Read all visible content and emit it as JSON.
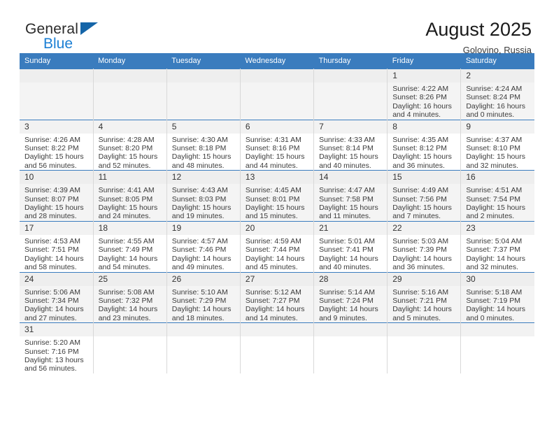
{
  "brand": {
    "name_part1": "General",
    "name_part2": "Blue",
    "triangle_icon": "triangle-icon",
    "accent_color": "#1b7fd4"
  },
  "header": {
    "title": "August 2025",
    "subtitle": "Golovino, Russia"
  },
  "theme": {
    "header_blue": "#3a7cbe",
    "row_alt": "#f4f4f4",
    "daynum_strip": "#eeeeee"
  },
  "weekday_headers": [
    "Sunday",
    "Monday",
    "Tuesday",
    "Wednesday",
    "Thursday",
    "Friday",
    "Saturday"
  ],
  "weeks": [
    [
      {
        "day": "",
        "empty": true
      },
      {
        "day": "",
        "empty": true
      },
      {
        "day": "",
        "empty": true
      },
      {
        "day": "",
        "empty": true
      },
      {
        "day": "",
        "empty": true
      },
      {
        "day": "1",
        "sunrise": "Sunrise: 4:22 AM",
        "sunset": "Sunset: 8:26 PM",
        "daylight_line1": "Daylight: 16 hours",
        "daylight_line2": "and 4 minutes."
      },
      {
        "day": "2",
        "sunrise": "Sunrise: 4:24 AM",
        "sunset": "Sunset: 8:24 PM",
        "daylight_line1": "Daylight: 16 hours",
        "daylight_line2": "and 0 minutes."
      }
    ],
    [
      {
        "day": "3",
        "sunrise": "Sunrise: 4:26 AM",
        "sunset": "Sunset: 8:22 PM",
        "daylight_line1": "Daylight: 15 hours",
        "daylight_line2": "and 56 minutes."
      },
      {
        "day": "4",
        "sunrise": "Sunrise: 4:28 AM",
        "sunset": "Sunset: 8:20 PM",
        "daylight_line1": "Daylight: 15 hours",
        "daylight_line2": "and 52 minutes."
      },
      {
        "day": "5",
        "sunrise": "Sunrise: 4:30 AM",
        "sunset": "Sunset: 8:18 PM",
        "daylight_line1": "Daylight: 15 hours",
        "daylight_line2": "and 48 minutes."
      },
      {
        "day": "6",
        "sunrise": "Sunrise: 4:31 AM",
        "sunset": "Sunset: 8:16 PM",
        "daylight_line1": "Daylight: 15 hours",
        "daylight_line2": "and 44 minutes."
      },
      {
        "day": "7",
        "sunrise": "Sunrise: 4:33 AM",
        "sunset": "Sunset: 8:14 PM",
        "daylight_line1": "Daylight: 15 hours",
        "daylight_line2": "and 40 minutes."
      },
      {
        "day": "8",
        "sunrise": "Sunrise: 4:35 AM",
        "sunset": "Sunset: 8:12 PM",
        "daylight_line1": "Daylight: 15 hours",
        "daylight_line2": "and 36 minutes."
      },
      {
        "day": "9",
        "sunrise": "Sunrise: 4:37 AM",
        "sunset": "Sunset: 8:10 PM",
        "daylight_line1": "Daylight: 15 hours",
        "daylight_line2": "and 32 minutes."
      }
    ],
    [
      {
        "day": "10",
        "sunrise": "Sunrise: 4:39 AM",
        "sunset": "Sunset: 8:07 PM",
        "daylight_line1": "Daylight: 15 hours",
        "daylight_line2": "and 28 minutes."
      },
      {
        "day": "11",
        "sunrise": "Sunrise: 4:41 AM",
        "sunset": "Sunset: 8:05 PM",
        "daylight_line1": "Daylight: 15 hours",
        "daylight_line2": "and 24 minutes."
      },
      {
        "day": "12",
        "sunrise": "Sunrise: 4:43 AM",
        "sunset": "Sunset: 8:03 PM",
        "daylight_line1": "Daylight: 15 hours",
        "daylight_line2": "and 19 minutes."
      },
      {
        "day": "13",
        "sunrise": "Sunrise: 4:45 AM",
        "sunset": "Sunset: 8:01 PM",
        "daylight_line1": "Daylight: 15 hours",
        "daylight_line2": "and 15 minutes."
      },
      {
        "day": "14",
        "sunrise": "Sunrise: 4:47 AM",
        "sunset": "Sunset: 7:58 PM",
        "daylight_line1": "Daylight: 15 hours",
        "daylight_line2": "and 11 minutes."
      },
      {
        "day": "15",
        "sunrise": "Sunrise: 4:49 AM",
        "sunset": "Sunset: 7:56 PM",
        "daylight_line1": "Daylight: 15 hours",
        "daylight_line2": "and 7 minutes."
      },
      {
        "day": "16",
        "sunrise": "Sunrise: 4:51 AM",
        "sunset": "Sunset: 7:54 PM",
        "daylight_line1": "Daylight: 15 hours",
        "daylight_line2": "and 2 minutes."
      }
    ],
    [
      {
        "day": "17",
        "sunrise": "Sunrise: 4:53 AM",
        "sunset": "Sunset: 7:51 PM",
        "daylight_line1": "Daylight: 14 hours",
        "daylight_line2": "and 58 minutes."
      },
      {
        "day": "18",
        "sunrise": "Sunrise: 4:55 AM",
        "sunset": "Sunset: 7:49 PM",
        "daylight_line1": "Daylight: 14 hours",
        "daylight_line2": "and 54 minutes."
      },
      {
        "day": "19",
        "sunrise": "Sunrise: 4:57 AM",
        "sunset": "Sunset: 7:46 PM",
        "daylight_line1": "Daylight: 14 hours",
        "daylight_line2": "and 49 minutes."
      },
      {
        "day": "20",
        "sunrise": "Sunrise: 4:59 AM",
        "sunset": "Sunset: 7:44 PM",
        "daylight_line1": "Daylight: 14 hours",
        "daylight_line2": "and 45 minutes."
      },
      {
        "day": "21",
        "sunrise": "Sunrise: 5:01 AM",
        "sunset": "Sunset: 7:41 PM",
        "daylight_line1": "Daylight: 14 hours",
        "daylight_line2": "and 40 minutes."
      },
      {
        "day": "22",
        "sunrise": "Sunrise: 5:03 AM",
        "sunset": "Sunset: 7:39 PM",
        "daylight_line1": "Daylight: 14 hours",
        "daylight_line2": "and 36 minutes."
      },
      {
        "day": "23",
        "sunrise": "Sunrise: 5:04 AM",
        "sunset": "Sunset: 7:37 PM",
        "daylight_line1": "Daylight: 14 hours",
        "daylight_line2": "and 32 minutes."
      }
    ],
    [
      {
        "day": "24",
        "sunrise": "Sunrise: 5:06 AM",
        "sunset": "Sunset: 7:34 PM",
        "daylight_line1": "Daylight: 14 hours",
        "daylight_line2": "and 27 minutes."
      },
      {
        "day": "25",
        "sunrise": "Sunrise: 5:08 AM",
        "sunset": "Sunset: 7:32 PM",
        "daylight_line1": "Daylight: 14 hours",
        "daylight_line2": "and 23 minutes."
      },
      {
        "day": "26",
        "sunrise": "Sunrise: 5:10 AM",
        "sunset": "Sunset: 7:29 PM",
        "daylight_line1": "Daylight: 14 hours",
        "daylight_line2": "and 18 minutes."
      },
      {
        "day": "27",
        "sunrise": "Sunrise: 5:12 AM",
        "sunset": "Sunset: 7:27 PM",
        "daylight_line1": "Daylight: 14 hours",
        "daylight_line2": "and 14 minutes."
      },
      {
        "day": "28",
        "sunrise": "Sunrise: 5:14 AM",
        "sunset": "Sunset: 7:24 PM",
        "daylight_line1": "Daylight: 14 hours",
        "daylight_line2": "and 9 minutes."
      },
      {
        "day": "29",
        "sunrise": "Sunrise: 5:16 AM",
        "sunset": "Sunset: 7:21 PM",
        "daylight_line1": "Daylight: 14 hours",
        "daylight_line2": "and 5 minutes."
      },
      {
        "day": "30",
        "sunrise": "Sunrise: 5:18 AM",
        "sunset": "Sunset: 7:19 PM",
        "daylight_line1": "Daylight: 14 hours",
        "daylight_line2": "and 0 minutes."
      }
    ],
    [
      {
        "day": "31",
        "sunrise": "Sunrise: 5:20 AM",
        "sunset": "Sunset: 7:16 PM",
        "daylight_line1": "Daylight: 13 hours",
        "daylight_line2": "and 56 minutes."
      },
      {
        "day": "",
        "empty": true
      },
      {
        "day": "",
        "empty": true
      },
      {
        "day": "",
        "empty": true
      },
      {
        "day": "",
        "empty": true
      },
      {
        "day": "",
        "empty": true
      },
      {
        "day": "",
        "empty": true
      }
    ]
  ]
}
